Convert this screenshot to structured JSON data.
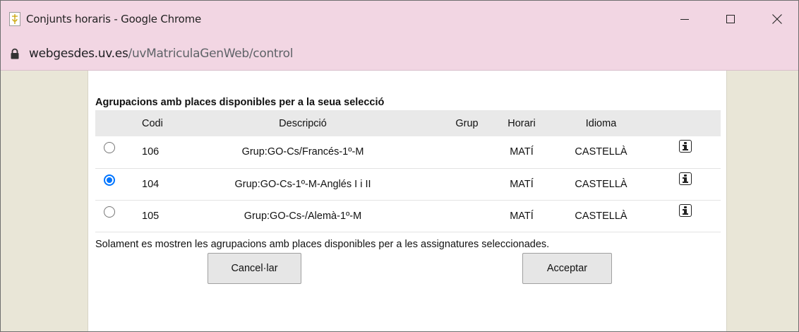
{
  "window": {
    "title": "Conjunts horaris - Google Chrome",
    "url_host": "webgesdes.uv.es",
    "url_path": "/uvMatriculaGenWeb/control"
  },
  "main": {
    "heading": "Agrupacions amb places disponibles per a la seua selecció",
    "columns": [
      "Codi",
      "Descripció",
      "Grup",
      "Horari",
      "Idioma"
    ],
    "rows": [
      {
        "codi": "106",
        "descripcio": "Grup:GO-Cs/Francés-1º-M",
        "grup": "",
        "horari": "MATÍ",
        "idioma": "CASTELLÀ",
        "selected": false
      },
      {
        "codi": "104",
        "descripcio": "Grup:GO-Cs-1º-M-Anglés I i II",
        "grup": "",
        "horari": "MATÍ",
        "idioma": "CASTELLÀ",
        "selected": true
      },
      {
        "codi": "105",
        "descripcio": "Grup:GO-Cs-/Alemà-1º-M",
        "grup": "",
        "horari": "MATÍ",
        "idioma": "CASTELLÀ",
        "selected": false
      }
    ],
    "note": "Solament es mostren les agrupacions amb places disponibles per a les assignatures seleccionades.",
    "cancel_label": "Cancel·lar",
    "accept_label": "Acceptar"
  },
  "colors": {
    "chrome_frame": "#f2d6e3",
    "page_background": "#e9e6d7",
    "radio_accent": "#0075ff"
  }
}
